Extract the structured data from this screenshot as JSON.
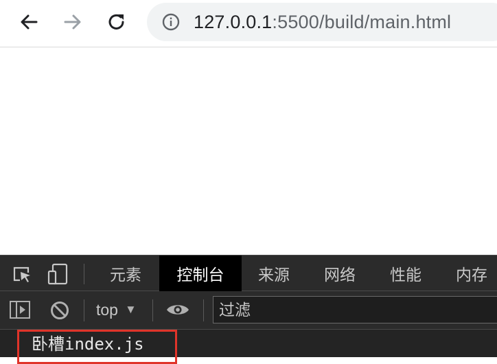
{
  "browser": {
    "url_host": "127.0.0.1",
    "url_rest": ":5500/build/main.html",
    "icons": {
      "back": "arrow-left-icon",
      "forward": "arrow-right-icon",
      "reload": "reload-icon",
      "site_info": "info-icon"
    }
  },
  "devtools": {
    "tabs": [
      {
        "label": "元素",
        "active": false
      },
      {
        "label": "控制台",
        "active": true
      },
      {
        "label": "来源",
        "active": false
      },
      {
        "label": "网络",
        "active": false
      },
      {
        "label": "性能",
        "active": false
      },
      {
        "label": "内存",
        "active": false
      }
    ],
    "toolbar": {
      "context": "top",
      "context_arrow": "▼",
      "filter_placeholder": "过滤"
    },
    "console": {
      "lines": [
        "卧槽index.js"
      ]
    }
  },
  "colors": {
    "devtools_bg": "#242424",
    "active_tab_bg": "#000000",
    "highlight": "#e0342a"
  }
}
